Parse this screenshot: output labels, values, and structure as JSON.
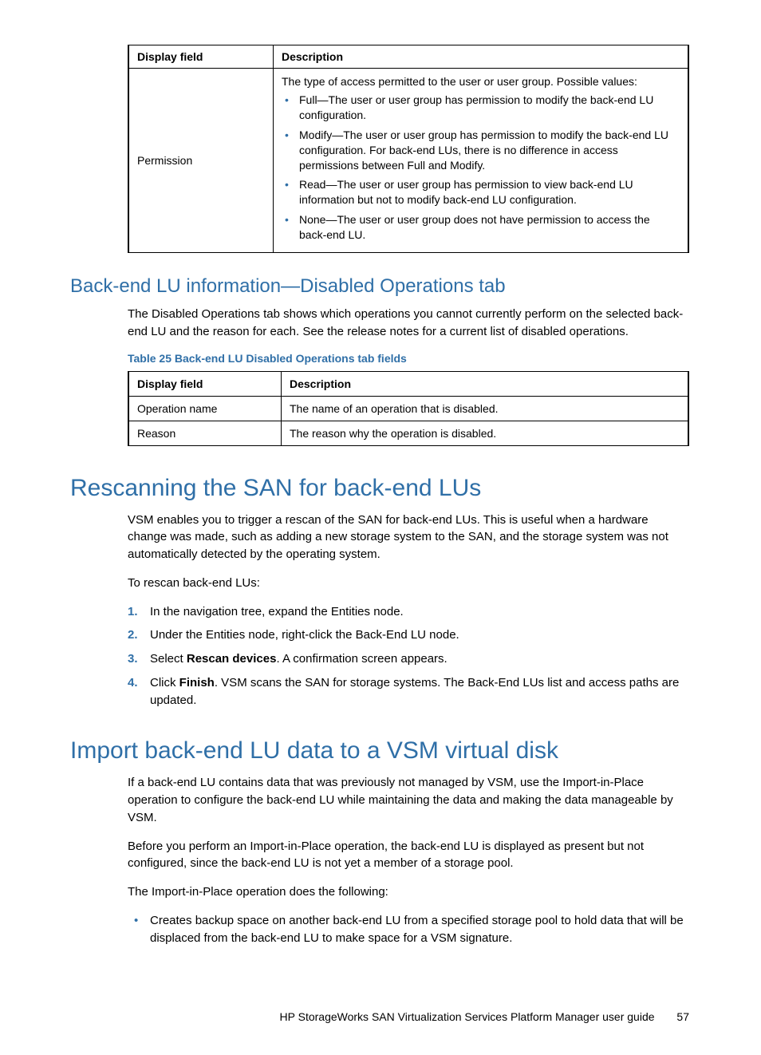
{
  "table1": {
    "header_left": "Display field",
    "header_right": "Description",
    "row_field": "Permission",
    "row_desc_intro": "The type of access permitted to the user or user group. Possible values:",
    "bullets": [
      "Full—The user or user group has permission to modify the back-end LU configuration.",
      "Modify—The user or user group has permission to modify the back-end LU configuration. For back-end LUs, there is no difference in access permissions between Full and Modify.",
      "Read—The user or user group has permission to view back-end LU information but not to modify back-end LU configuration.",
      "None—The user or user group does not have permission to access the back-end LU."
    ]
  },
  "section1": {
    "heading": "Back-end LU information—Disabled Operations tab",
    "para": "The Disabled Operations tab shows which operations you cannot currently perform on the selected back-end LU and the reason for each. See the release notes for a current list of disabled operations.",
    "table_caption": "Table 25 Back-end LU Disabled Operations tab fields",
    "table": {
      "header_left": "Display field",
      "header_right": "Description",
      "rows": [
        {
          "field": "Operation name",
          "desc": "The name of an operation that is disabled."
        },
        {
          "field": "Reason",
          "desc": "The reason why the operation is disabled."
        }
      ]
    }
  },
  "chapter1": {
    "heading": "Rescanning the SAN for back-end LUs",
    "para1": "VSM enables you to trigger a rescan of the SAN for back-end LUs. This is useful when a hardware change was made, such as adding a new storage system to the SAN, and the storage system was not automatically detected by the operating system.",
    "lead": "To rescan back-end LUs:",
    "steps": {
      "s1": "In the navigation tree, expand the Entities node.",
      "s2": "Under the Entities node, right-click the Back-End LU node.",
      "s3_pre": "Select ",
      "s3_bold": "Rescan devices",
      "s3_post": ". A confirmation screen appears.",
      "s4_pre": "Click ",
      "s4_bold": "Finish",
      "s4_post": ". VSM scans the SAN for storage systems. The Back-End LUs list and access paths are updated."
    }
  },
  "chapter2": {
    "heading": "Import back-end LU data to a VSM virtual disk",
    "para1": "If a back-end LU contains data that was previously not managed by VSM, use the Import-in-Place operation to configure the back-end LU while maintaining the data and making the data manageable by VSM.",
    "para2": "Before you perform an Import-in-Place operation, the back-end LU is displayed as present but not configured, since the back-end LU is not yet a member of a storage pool.",
    "para3": "The Import-in-Place operation does the following:",
    "bullet1": "Creates backup space on another back-end LU from a specified storage pool to hold data that will be displaced from the back-end LU to make space for a VSM signature."
  },
  "footer": {
    "text": "HP StorageWorks SAN Virtualization Services Platform Manager user guide",
    "page": "57"
  }
}
